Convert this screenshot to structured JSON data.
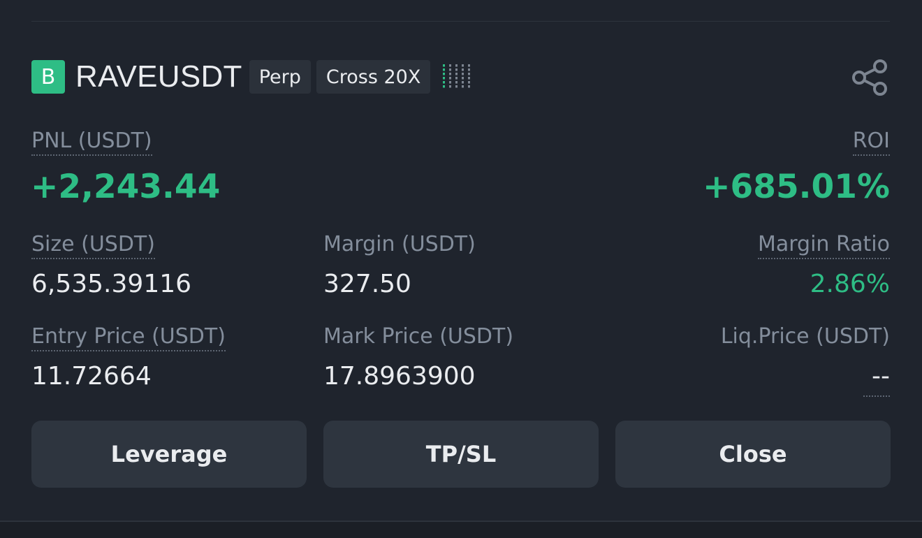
{
  "position": {
    "coin_letter": "B",
    "symbol": "RAVEUSDT",
    "type_tag": "Perp",
    "margin_tag": "Cross 20X",
    "signal_icon": "risk-signal-icon",
    "share_icon": "share-icon"
  },
  "pnl": {
    "label": "PNL (USDT)",
    "value": "+2,243.44"
  },
  "roi": {
    "label": "ROI",
    "value": "+685.01%"
  },
  "size": {
    "label": "Size (USDT)",
    "value": "6,535.39116"
  },
  "margin": {
    "label": "Margin (USDT)",
    "value": "327.50"
  },
  "margin_ratio": {
    "label": "Margin Ratio",
    "value": "2.86%"
  },
  "entry_price": {
    "label": "Entry Price (USDT)",
    "value": "11.72664"
  },
  "mark_price": {
    "label": "Mark Price (USDT)",
    "value": "17.8963900"
  },
  "liq_price": {
    "label": "Liq.Price (USDT)",
    "value": "--"
  },
  "actions": {
    "leverage": "Leverage",
    "tpsl": "TP/SL",
    "close": "Close"
  },
  "colors": {
    "positive": "#2ebd85",
    "background": "#1f242d",
    "button": "#2e353f"
  }
}
